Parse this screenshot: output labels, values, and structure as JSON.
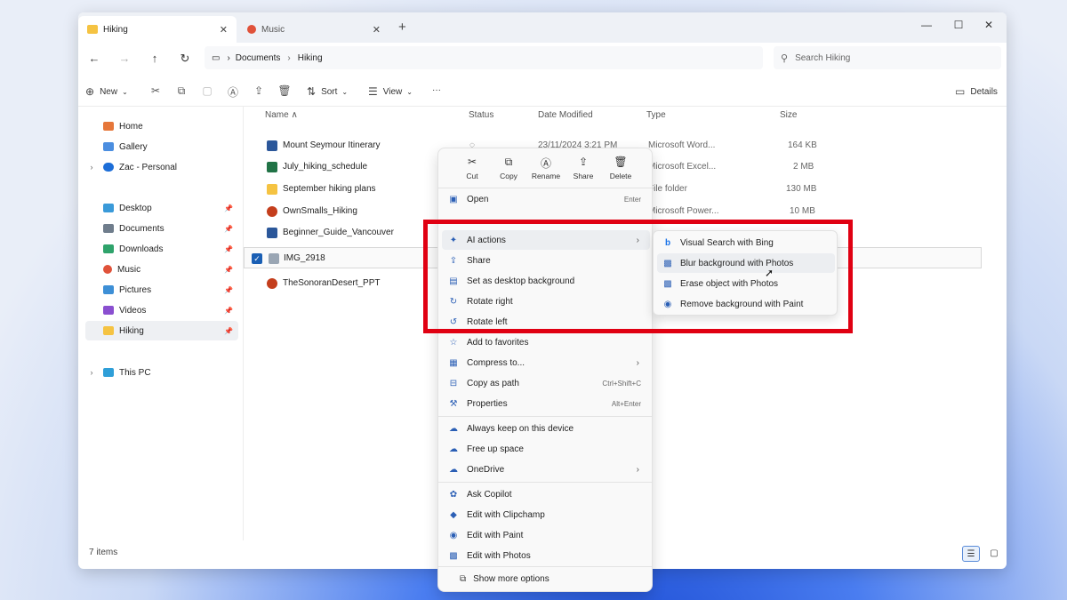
{
  "tabs": [
    {
      "label": "Hiking",
      "active": true,
      "icon": "folder-icon"
    },
    {
      "label": "Music",
      "active": false,
      "icon": "music-folder-icon"
    }
  ],
  "window_controls": {
    "minimize": "—",
    "maximize": "☐",
    "close": "✕"
  },
  "breadcrumb": [
    "Documents",
    "Hiking"
  ],
  "search": {
    "placeholder": "Search Hiking"
  },
  "commands": {
    "new": "New",
    "sort": "Sort",
    "view": "View",
    "more": "···",
    "details": "Details"
  },
  "sidebar": {
    "items": [
      {
        "label": "Home",
        "icon": "home-icon"
      },
      {
        "label": "Gallery",
        "icon": "gallery-icon"
      },
      {
        "label": "Zac - Personal",
        "icon": "onedrive-icon"
      },
      {
        "label": "Desktop",
        "icon": "desktop-icon"
      },
      {
        "label": "Documents",
        "icon": "documents-icon"
      },
      {
        "label": "Downloads",
        "icon": "downloads-icon"
      },
      {
        "label": "Music",
        "icon": "music-icon"
      },
      {
        "label": "Pictures",
        "icon": "pictures-icon"
      },
      {
        "label": "Videos",
        "icon": "videos-icon"
      },
      {
        "label": "Hiking",
        "icon": "folder-icon",
        "selected": true
      },
      {
        "label": "This PC",
        "icon": "pc-icon"
      }
    ]
  },
  "columns": {
    "name": "Name",
    "status": "Status",
    "date": "Date Modified",
    "type": "Type",
    "size": "Size"
  },
  "files": [
    {
      "name": "Mount Seymour Itinerary",
      "date": "23/11/2024 3:21 PM",
      "type": "Microsoft Word...",
      "size": "164 KB",
      "icon": "word-icon",
      "status": "◌"
    },
    {
      "name": "July_hiking_schedule",
      "date": "",
      "type": "Microsoft Excel...",
      "size": "2 MB",
      "icon": "excel-icon",
      "status": ""
    },
    {
      "name": "September hiking plans",
      "date": "",
      "type": "File folder",
      "size": "130 MB",
      "icon": "folder-icon",
      "status": ""
    },
    {
      "name": "OwnSmalls_Hiking",
      "date": "",
      "type": "Microsoft Power...",
      "size": "10 MB",
      "icon": "powerpoint-icon",
      "status": ""
    },
    {
      "name": "Beginner_Guide_Vancouver",
      "date": "",
      "type": "Microsoft Word...",
      "size": "",
      "icon": "word-icon",
      "status": ""
    },
    {
      "name": "IMG_2918",
      "date": "",
      "type": "",
      "size": "",
      "icon": "image-icon",
      "status": "",
      "selected": true
    },
    {
      "name": "TheSonoranDesert_PPT",
      "date": "",
      "type": "",
      "size": "",
      "icon": "powerpoint-icon",
      "status": ""
    }
  ],
  "status_bar": {
    "count": "7 items"
  },
  "context_menu": {
    "quick_actions": [
      {
        "label": "Cut",
        "icon": "cut-icon",
        "glyph": "✂"
      },
      {
        "label": "Copy",
        "icon": "copy-icon",
        "glyph": "⧉"
      },
      {
        "label": "Rename",
        "icon": "rename-icon",
        "glyph": "Ⓐ"
      },
      {
        "label": "Share",
        "icon": "share-icon",
        "glyph": "⇪"
      },
      {
        "label": "Delete",
        "icon": "delete-icon",
        "glyph": "🗑"
      }
    ],
    "items": [
      {
        "label": "Open",
        "shortcut": "Enter",
        "icon": "open-icon",
        "glyph": "▣"
      },
      {
        "label": "AI actions",
        "shortcut": "",
        "icon": "ai-icon",
        "glyph": "✦",
        "submenu": true,
        "highlighted": true
      },
      {
        "label": "Share",
        "shortcut": "",
        "icon": "share-icon",
        "glyph": "⇪"
      },
      {
        "label": "Set as desktop background",
        "shortcut": "",
        "icon": "wallpaper-icon",
        "glyph": "▤"
      },
      {
        "label": "Rotate right",
        "shortcut": "",
        "icon": "rotate-right-icon",
        "glyph": "↻"
      },
      {
        "label": "Rotate left",
        "shortcut": "",
        "icon": "rotate-left-icon",
        "glyph": "↺"
      },
      {
        "label": "Add to favorites",
        "shortcut": "",
        "icon": "star-icon",
        "glyph": "☆"
      },
      {
        "label": "Compress to...",
        "shortcut": "",
        "icon": "zip-icon",
        "glyph": "▦",
        "submenu": true
      },
      {
        "label": "Copy as path",
        "shortcut": "Ctrl+Shift+C",
        "icon": "path-icon",
        "glyph": "⊟"
      },
      {
        "label": "Properties",
        "shortcut": "Alt+Enter",
        "icon": "properties-icon",
        "glyph": "⚒"
      },
      {
        "label": "Always keep on this device",
        "shortcut": "",
        "icon": "cloud-keep-icon",
        "glyph": "☁"
      },
      {
        "label": "Free up space",
        "shortcut": "",
        "icon": "cloud-icon",
        "glyph": "☁"
      },
      {
        "label": "OneDrive",
        "shortcut": "",
        "icon": "onedrive-icon",
        "glyph": "☁",
        "submenu": true
      },
      {
        "label": "Ask Copilot",
        "shortcut": "",
        "icon": "copilot-icon",
        "glyph": "✿"
      },
      {
        "label": "Edit with Clipchamp",
        "shortcut": "",
        "icon": "clipchamp-icon",
        "glyph": "◆"
      },
      {
        "label": "Edit with Paint",
        "shortcut": "",
        "icon": "paint-icon",
        "glyph": "◉"
      },
      {
        "label": "Edit with Photos",
        "shortcut": "",
        "icon": "photos-icon",
        "glyph": "▩"
      }
    ],
    "show_more": "Show more options"
  },
  "ai_submenu": [
    {
      "label": "Visual Search with Bing",
      "icon": "bing-icon",
      "glyph": "b"
    },
    {
      "label": "Blur background with Photos",
      "icon": "photos-icon",
      "glyph": "▩",
      "highlighted": true
    },
    {
      "label": "Erase object with Photos",
      "icon": "photos-icon",
      "glyph": "▩"
    },
    {
      "label": "Remove background with Paint",
      "icon": "paint-icon",
      "glyph": "◉"
    }
  ],
  "colors": {
    "highlight_border": "#e00012",
    "accent": "#2b5fb5"
  }
}
